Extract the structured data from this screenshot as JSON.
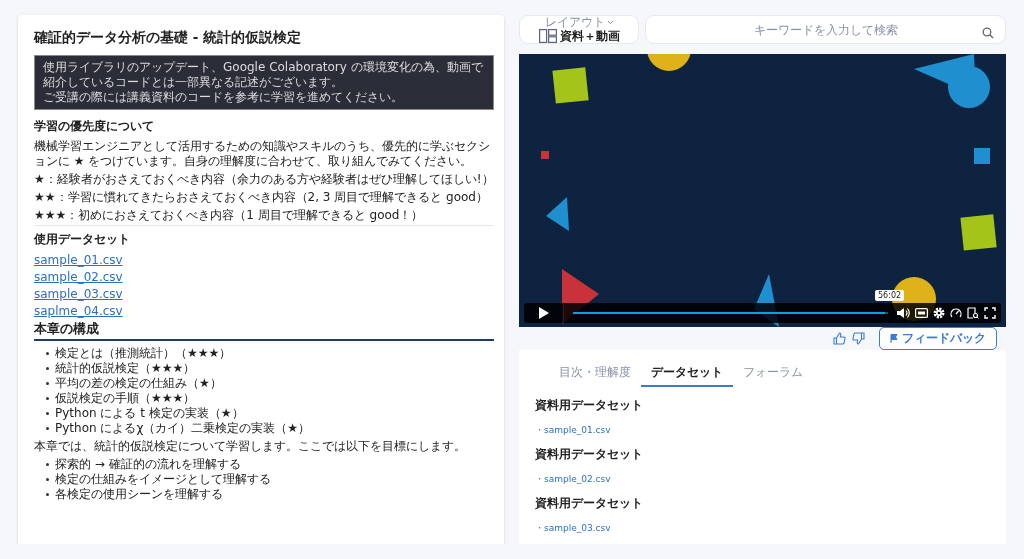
{
  "article": {
    "title": "確証的データ分析の基礎 - 統計的仮説検定",
    "notice": [
      "使用ライブラリのアップデート、Google Colaboratory の環境変化の為、動画で紹介しているコードとは一部異なる記述がございます。",
      "ご受講の際には講義資料のコードを参考に学習を進めてください。"
    ],
    "priority_heading": "学習の優先度について",
    "priority_text": "機械学習エンジニアとして活用するための知識やスキルのうち、優先的に学ぶセクションに ★ をつけています。自身の理解度に合わせて、取り組んでみてください。",
    "priority_levels": [
      "★：経験者がおさえておくべき内容（余力のある方や経験者はぜひ理解してほしい!）",
      "★★：学習に慣れてきたらおさえておくべき内容（2, 3 周目で理解できると good）",
      "★★★：初めにおさえておくべき内容（1 周目で理解できると good！）"
    ],
    "dataset_heading": "使用データセット",
    "dataset_links": [
      "sample_01.csv",
      "sample_02.csv",
      "sample_03.csv",
      "saplme_04.csv"
    ],
    "section_heading": "本章の構成",
    "sections": [
      "検定とは（推測統計）（★★★）",
      "統計的仮説検定（★★★）",
      "平均の差の検定の仕組み（★）",
      "仮説検定の手順（★★★）",
      "Python による t 検定の実装（★）",
      "Python によるχ（カイ）二乗検定の実装（★）"
    ],
    "goal_text": "本章では、統計的仮説検定について学習します。ここでは以下を目標にします。",
    "goals": [
      "探索的 → 確証的の流れを理解する",
      "検定の仕組みをイメージとして理解する",
      "各検定の使用シーンを理解する"
    ]
  },
  "layout_button": {
    "label": "レイアウト",
    "value": "資料＋動画"
  },
  "search": {
    "placeholder": "キーワードを入力して検索"
  },
  "video": {
    "kind": "picture",
    "time_tooltip": "56:02",
    "level": 0.99
  },
  "feedback_button": "フィードバック",
  "tabs": [
    {
      "label": "目次・理解度",
      "selected": false
    },
    {
      "label": "データセット",
      "selected": true
    },
    {
      "label": "フォーラム",
      "selected": false
    }
  ],
  "datasets": [
    {
      "heading": "資料用データセット",
      "file": "・sample_01.csv"
    },
    {
      "heading": "資料用データセット",
      "file": "・sample_02.csv"
    },
    {
      "heading": "資料用データセット",
      "file": "・sample_03.csv"
    }
  ]
}
